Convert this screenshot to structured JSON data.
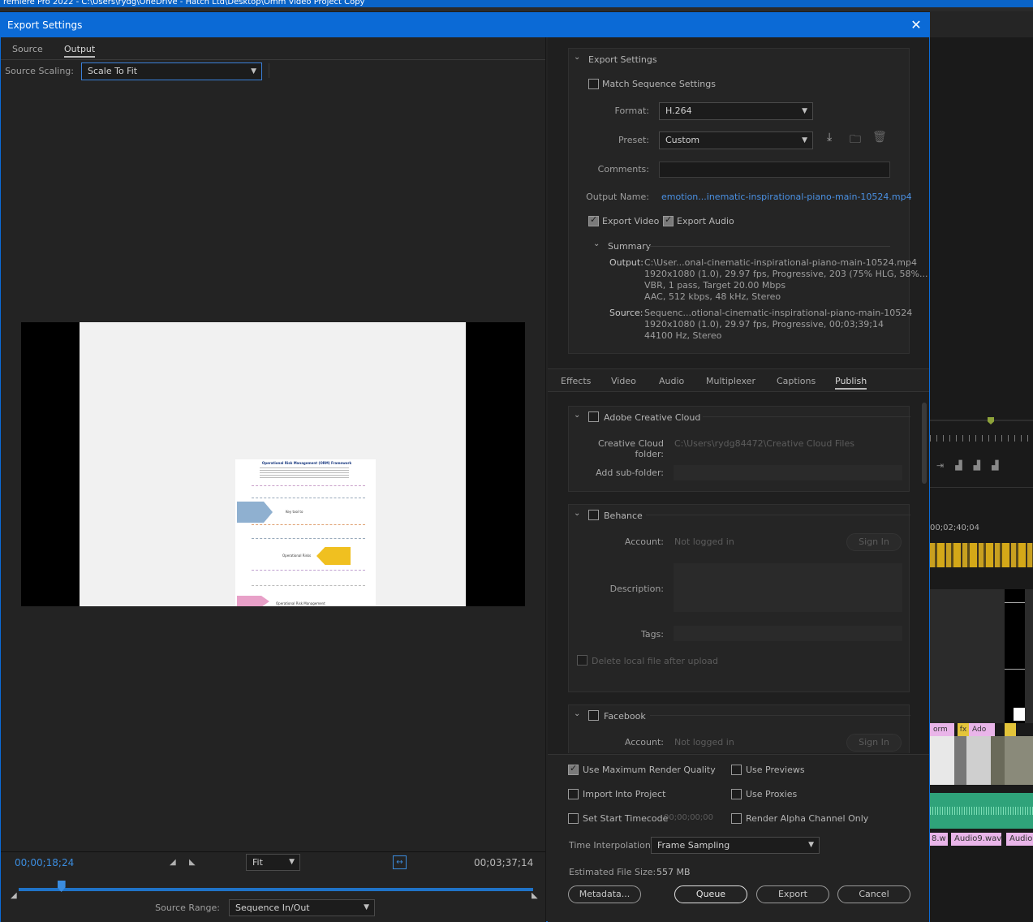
{
  "app_title": "remiere Pro 2022 - C:\\Users\\rydg\\OneDrive - Hatch Ltd\\Desktop\\Omm Video Project Copy",
  "dialog": {
    "title": "Export Settings",
    "close_label": "✕"
  },
  "source_tabs": {
    "source": "Source",
    "output": "Output"
  },
  "source_scaling": {
    "label": "Source Scaling:",
    "value": "Scale To Fit"
  },
  "preview_doc": {
    "title": "Operational Risk Management (ORM) Framework",
    "center_label": "Key tool to",
    "mid_label": "Operational Risks",
    "bottom_label": "Operational Risk Management"
  },
  "timeline": {
    "current_time": "00;00;18;24",
    "duration": "00;03;37;14",
    "zoom": "Fit",
    "playhead": 0.083,
    "source_range_label": "Source Range:",
    "source_range_value": "Sequence In/Out"
  },
  "export_settings": {
    "header": "Export Settings",
    "match_sequence": "Match Sequence Settings",
    "format_label": "Format:",
    "format_value": "H.264",
    "preset_label": "Preset:",
    "preset_value": "Custom",
    "comments_label": "Comments:",
    "output_name_label": "Output Name:",
    "output_name_value": "emotion...inematic-inspirational-piano-main-10524.mp4",
    "export_video": "Export Video",
    "export_audio": "Export Audio"
  },
  "summary": {
    "header": "Summary",
    "output_label": "Output:",
    "output_lines": [
      "C:\\User...onal-cinematic-inspirational-piano-main-10524.mp4",
      "1920x1080 (1.0), 29.97 fps, Progressive, 203 (75% HLG, 58%...",
      "VBR, 1 pass, Target 20.00 Mbps",
      "AAC, 512 kbps, 48 kHz, Stereo"
    ],
    "source_label": "Source:",
    "source_lines": [
      "Sequenc...otional-cinematic-inspirational-piano-main-10524",
      "1920x1080 (1.0), 29.97 fps, Progressive, 00;03;39;14",
      "44100 Hz, Stereo"
    ]
  },
  "settings_tabs": [
    "Effects",
    "Video",
    "Audio",
    "Multiplexer",
    "Captions",
    "Publish"
  ],
  "publish": {
    "creative_cloud": {
      "title": "Adobe Creative Cloud",
      "folder_label": "Creative Cloud folder:",
      "folder_value": "C:\\Users\\rydg84472\\Creative Cloud Files",
      "subfolder_label": "Add sub-folder:"
    },
    "behance": {
      "title": "Behance",
      "account_label": "Account:",
      "account_value": "Not logged in",
      "sign_in": "Sign In",
      "description_label": "Description:",
      "tags_label": "Tags:",
      "delete_local": "Delete local file after upload"
    },
    "facebook": {
      "title": "Facebook",
      "account_label": "Account:",
      "account_value": "Not logged in",
      "sign_in": "Sign In"
    }
  },
  "bottom": {
    "max_render": "Use Maximum Render Quality",
    "use_previews": "Use Previews",
    "import_project": "Import Into Project",
    "use_proxies": "Use Proxies",
    "set_start_tc": "Set Start Timecode",
    "start_tc_value": "00;00;00;00",
    "alpha_only": "Render Alpha Channel Only",
    "time_interp_label": "Time Interpolation:",
    "time_interp_value": "Frame Sampling",
    "file_size_label": "Estimated File Size:",
    "file_size_value": "557 MB",
    "metadata": "Metadata...",
    "queue": "Queue",
    "export": "Export",
    "cancel": "Cancel"
  },
  "bg_timeline": {
    "timecode": "00;02;40;04",
    "clip1": "orm",
    "clip2": "Ado",
    "audio1": "8.w",
    "audio2": "Audio9.wav",
    "audio3": "Audio",
    "fx": "fx"
  },
  "colors": {
    "accent": "#0b6ad6",
    "timecode_blue": "#3b8cde",
    "link_blue": "#4a90e2"
  }
}
